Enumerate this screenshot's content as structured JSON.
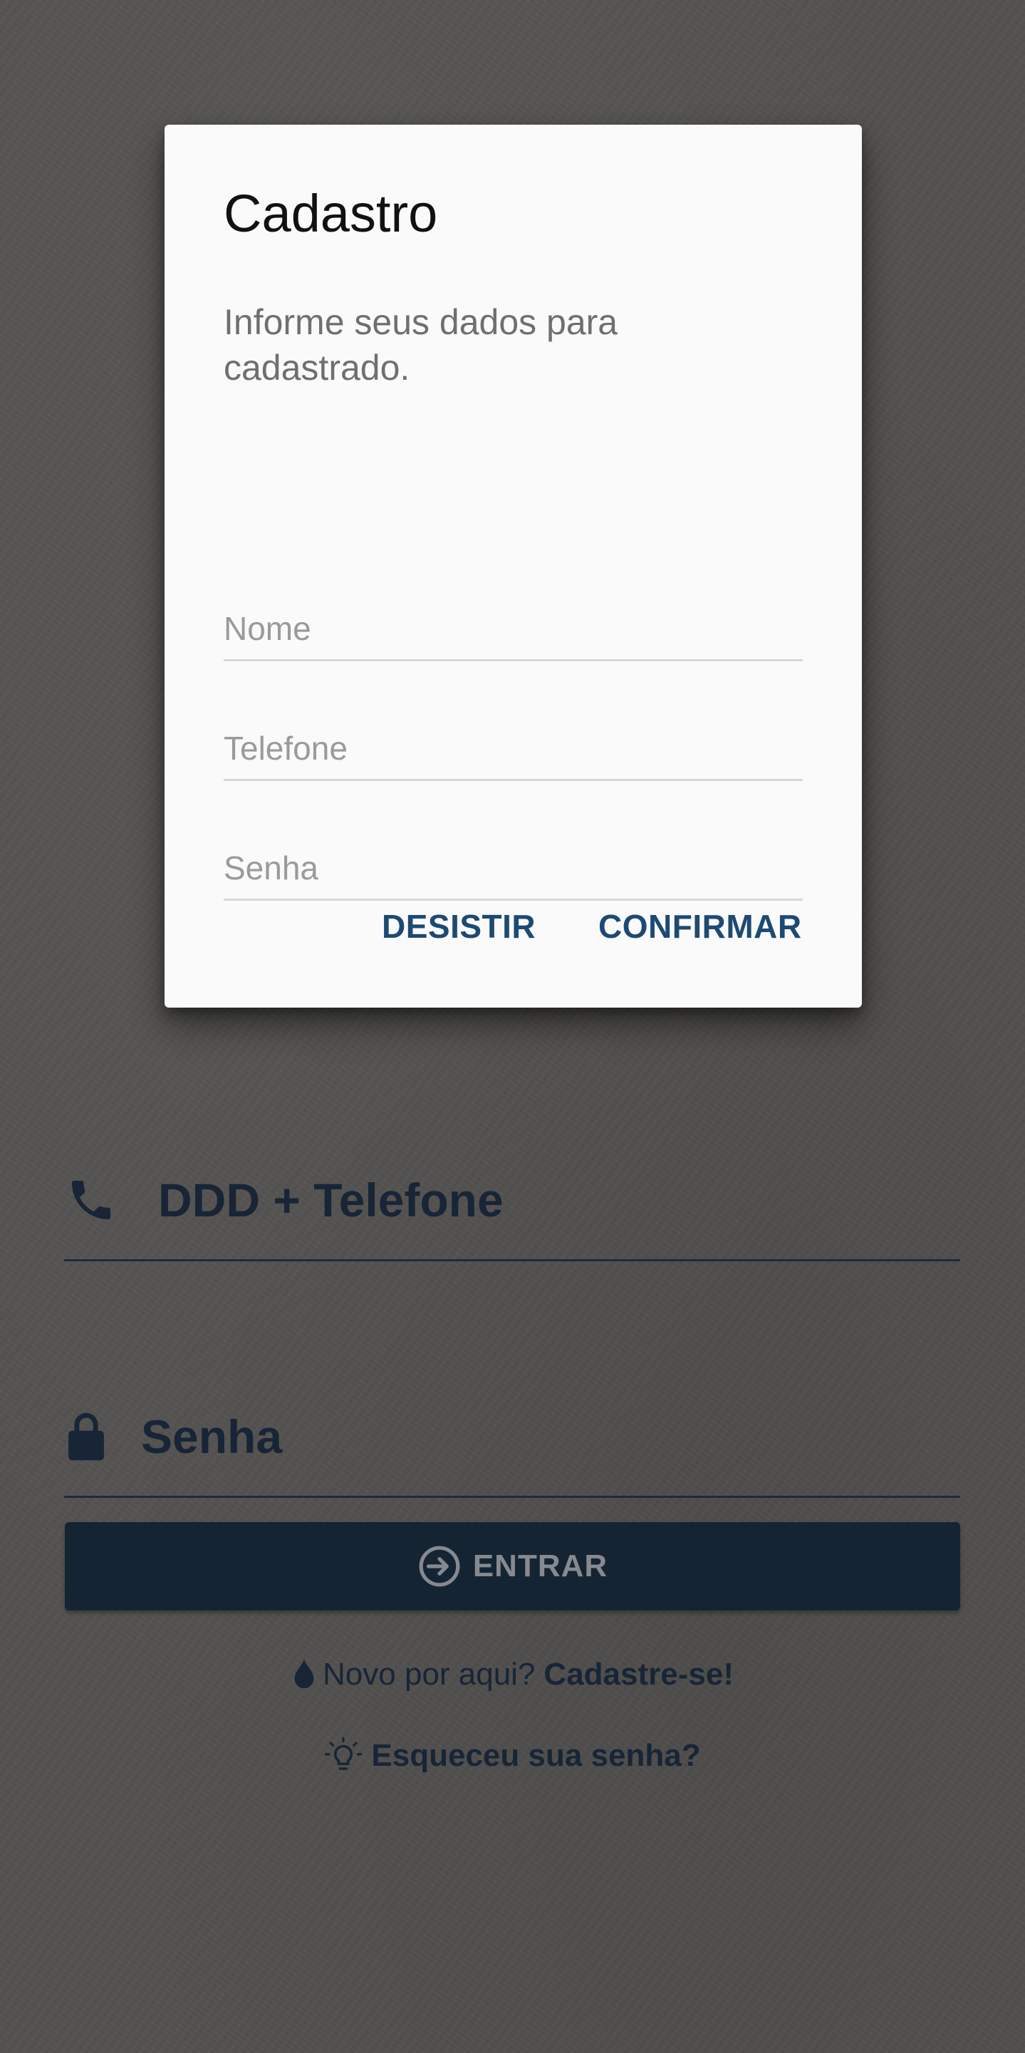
{
  "login": {
    "phone_field": {
      "placeholder": "DDD + Telefone",
      "icon": "phone-icon"
    },
    "password_field": {
      "placeholder": "Senha",
      "icon": "lock-icon"
    },
    "enter_button": {
      "label": "ENTRAR",
      "icon": "login-arrow-icon"
    },
    "signup": {
      "prefix": "Novo por aqui?",
      "link": "Cadastre-se!",
      "icon": "drop-icon"
    },
    "forgot": {
      "link": "Esqueceu sua senha?",
      "icon": "lightbulb-icon"
    }
  },
  "dialog": {
    "title": "Cadastro",
    "message": "Informe seus dados para cadastrado.",
    "fields": {
      "name_placeholder": "Nome",
      "phone_placeholder": "Telefone",
      "password_placeholder": "Senha"
    },
    "buttons": {
      "cancel": "DESISTIR",
      "confirm": "CONFIRMAR"
    }
  },
  "colors": {
    "brand_dark": "#0c2239",
    "text_dark": "#0f2440",
    "dialog_action": "#1d4a73",
    "background": "#6c6a67"
  }
}
